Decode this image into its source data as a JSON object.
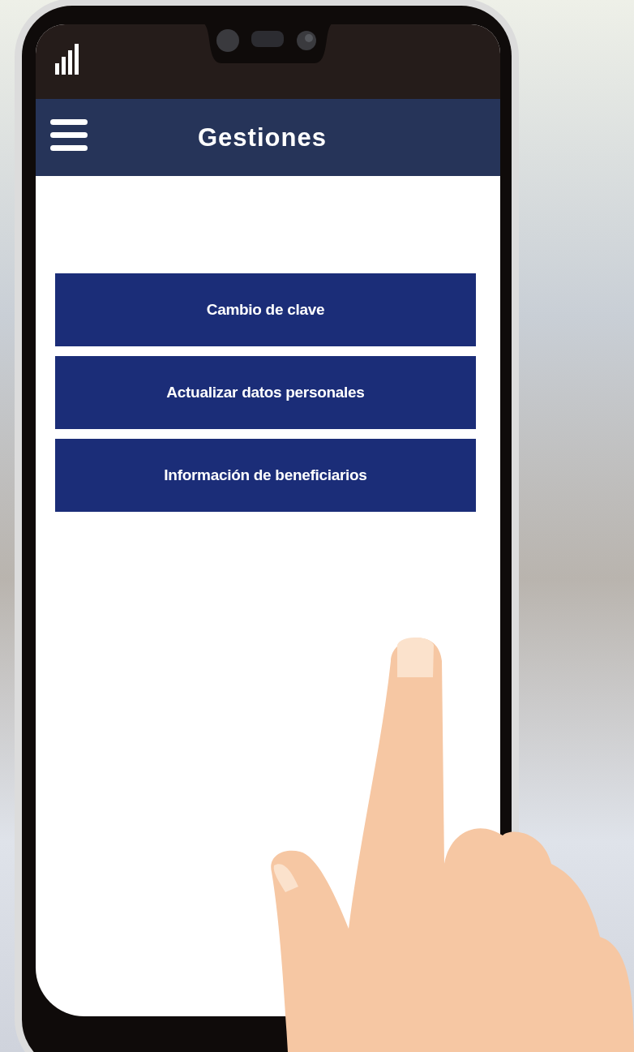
{
  "header": {
    "title": "Gestiones"
  },
  "buttons": [
    {
      "label": "Cambio de clave"
    },
    {
      "label": "Actualizar datos personales"
    },
    {
      "label": "Información de beneficiarios"
    }
  ]
}
